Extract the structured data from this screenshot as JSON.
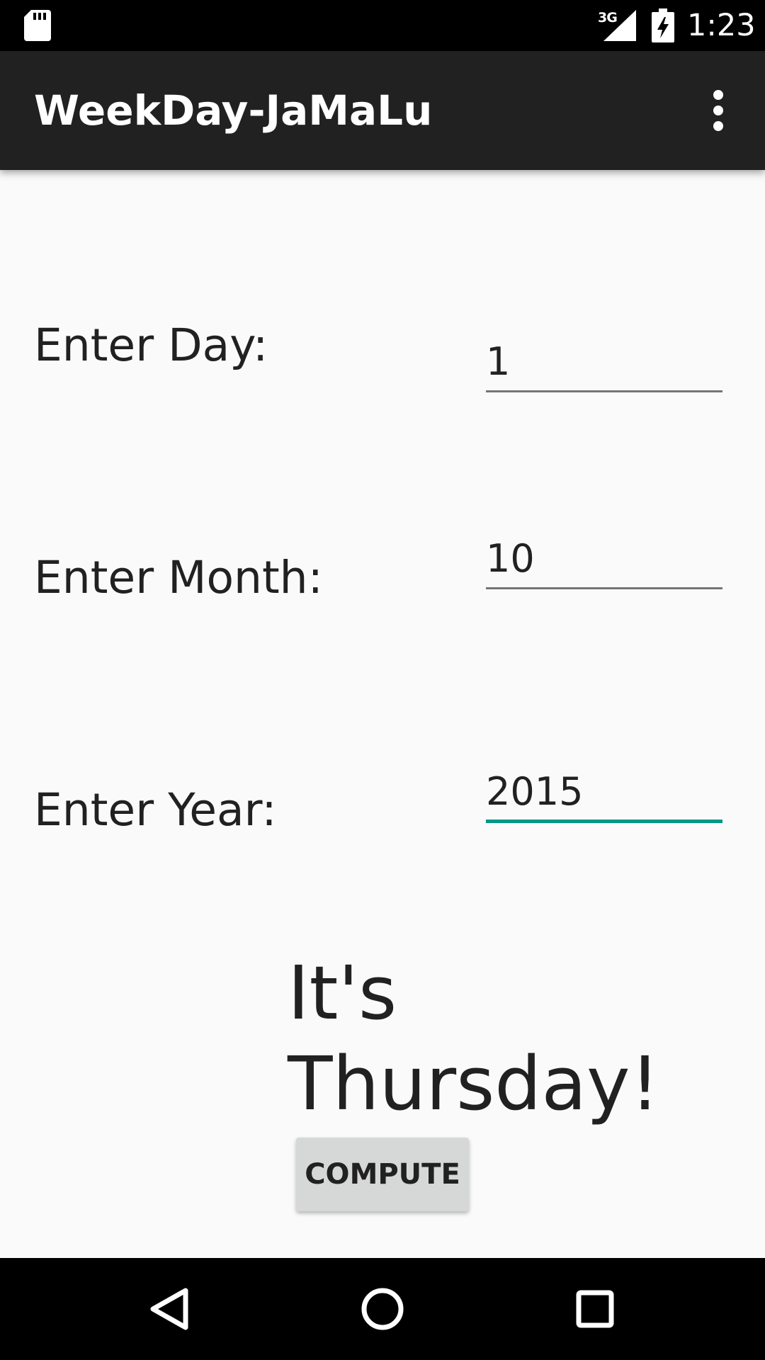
{
  "status_bar": {
    "time": "1:23",
    "network": "3G",
    "icons": [
      "sd-card-icon",
      "signal-icon",
      "battery-charging-icon"
    ]
  },
  "app_bar": {
    "title": "WeekDay-JaMaLu",
    "menu_icon": "overflow-menu-icon"
  },
  "form": {
    "day_label": "Enter Day:",
    "day_value": "1",
    "month_label": "Enter Month:",
    "month_value": "10",
    "year_label": "Enter Year:",
    "year_value": "2015"
  },
  "result": {
    "line1": "It's",
    "line2": "Thursday!"
  },
  "compute_button": {
    "label": "COMPUTE"
  },
  "nav_bar": {
    "icons": [
      "back-icon",
      "home-icon",
      "recents-icon"
    ]
  },
  "colors": {
    "accent": "#009688",
    "app_bar": "#212121",
    "background": "#fafafa",
    "button": "#d6d7d7"
  }
}
